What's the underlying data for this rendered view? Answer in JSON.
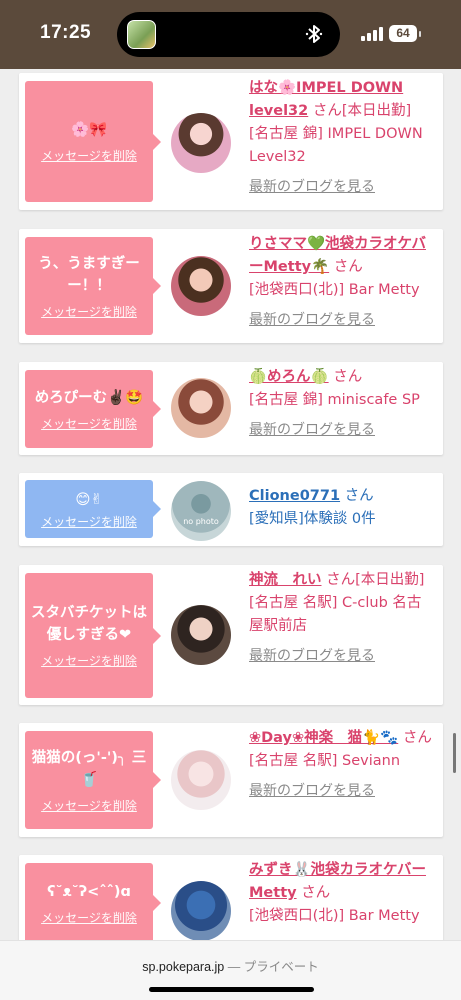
{
  "status_bar": {
    "time": "17:25",
    "battery": "64",
    "bar_color": "#5b4a3b"
  },
  "colors": {
    "pink": "#f9909f",
    "blue": "#8fb7f2",
    "link_pink": "#d9436c",
    "link_blue": "#2b6fb8"
  },
  "messages": [
    {
      "bubble_text": "🌸🎀",
      "bubble_color": "pink",
      "delete_label": "メッセージを削除",
      "name": "はな🌸IMPEL DOWN level32",
      "honorific": "さん",
      "status": "[本日出勤]",
      "location": "[名古屋 錦] IMPEL DOWN Level32",
      "blog_link": "最新のブログを見る"
    },
    {
      "bubble_text": "う、うますぎーー！！",
      "bubble_color": "pink",
      "delete_label": "メッセージを削除",
      "name": "りさママ💚池袋カラオケバーMetty🌴",
      "honorific": "さん",
      "status": "",
      "location": "[池袋西口(北)] Bar Metty",
      "blog_link": "最新のブログを見る"
    },
    {
      "bubble_text": "めろぴーむ✌🏿🤩",
      "bubble_color": "pink",
      "delete_label": "メッセージを削除",
      "name": "🍈めろん🍈",
      "honorific": "さん",
      "status": "",
      "location": "[名古屋 錦] miniscafe SP",
      "blog_link": "最新のブログを見る"
    },
    {
      "bubble_text": "😊✌",
      "bubble_color": "blue",
      "delete_label": "メッセージを削除",
      "name": "Clione0771",
      "honorific": "さん",
      "status": "",
      "location": "[愛知県]体験談 0件",
      "blog_link": "",
      "avatar_label": "no photo"
    },
    {
      "bubble_text": "スタバチケットは優しすぎる❤",
      "bubble_color": "pink",
      "delete_label": "メッセージを削除",
      "name": "神流　れい",
      "honorific": "さん",
      "status": "[本日出勤]",
      "location": "[名古屋 名駅] C-club 名古屋駅前店",
      "blog_link": "最新のブログを見る"
    },
    {
      "bubble_text": "猫猫の(っ'-')╮ 三 🥤",
      "bubble_color": "pink",
      "delete_label": "メッセージを削除",
      "name": "❀Day❀神楽　猫🐈🐾",
      "honorific": "さん",
      "status": "",
      "location": "[名古屋 名駅] Seviann",
      "blog_link": "最新のブログを見る"
    },
    {
      "bubble_text": "ʕ˘ᴥ˘ʔ<ˆˆ)ɑ",
      "bubble_color": "pink",
      "delete_label": "メッセージを削除",
      "name": "みずき🐰池袋カラオケバーMetty",
      "honorific": "さん",
      "status": "",
      "location": "[池袋西口(北)] Bar Metty",
      "blog_link": ""
    }
  ],
  "browser": {
    "domain": "sp.pokepara.jp",
    "separator": "—",
    "mode": "プライベート"
  }
}
